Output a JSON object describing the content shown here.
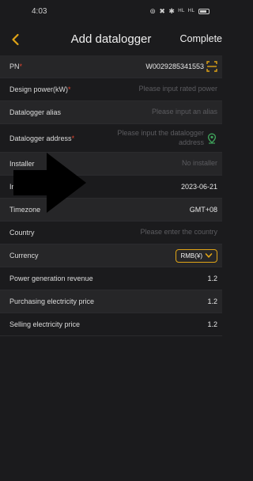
{
  "status": {
    "time": "4:03",
    "icons": "⊚ ✖ ✱ ᴴᴸ ᴴᴸ"
  },
  "header": {
    "title": "Add datalogger",
    "complete": "Complete"
  },
  "accent_color": "#e0a416",
  "required_color": "#e5452f",
  "rows": [
    {
      "label": "PN",
      "required": true,
      "value": "W0029285341553",
      "icon": "scan-icon"
    },
    {
      "label": "Design power(kW)",
      "required": true,
      "placeholder": "Please input rated power"
    },
    {
      "label": "Datalogger alias",
      "required": false,
      "placeholder": "Please input an alias"
    },
    {
      "label": "Datalogger address",
      "required": true,
      "placeholder_line1": "Please input the datalogger",
      "placeholder_line2": "address",
      "icon": "location-icon"
    },
    {
      "label": "Installer",
      "required": false,
      "placeholder": "No installer"
    },
    {
      "label": "Ins",
      "required": false,
      "value": "2023-06-21"
    },
    {
      "label": "Timezone",
      "required": false,
      "value": "GMT+08"
    },
    {
      "label": "Country",
      "required": false,
      "placeholder": "Please enter the country"
    },
    {
      "label": "Currency",
      "required": false,
      "value": "RMB(¥)",
      "icon": "chevron-down-icon"
    },
    {
      "label": "Power generation revenue",
      "required": false,
      "value": "1.2"
    },
    {
      "label": "Purchasing electricity price",
      "required": false,
      "value": "1.2"
    },
    {
      "label": "Selling electricity price",
      "required": false,
      "value": "1.2"
    }
  ]
}
